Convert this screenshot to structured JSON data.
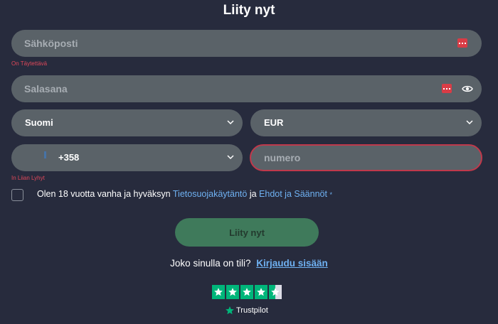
{
  "title": "Liity nyt",
  "email": {
    "placeholder": "Sähköposti",
    "error": "On Täytettävä"
  },
  "password": {
    "placeholder": "Salasana"
  },
  "country": {
    "selected": "Suomi"
  },
  "currency": {
    "selected": "EUR"
  },
  "phone": {
    "code": "+358",
    "number_placeholder": "numero",
    "error": "In Liian Lyhyt"
  },
  "consent": {
    "prefix": "Olen 18 vuotta vanha ja hyväksyn",
    "privacy_link": "Tietosuojakäytäntö",
    "middle": "ja",
    "terms_link": "Ehdot ja Säännöt",
    "required_mark": "*"
  },
  "submit_label": "Liity nyt",
  "login": {
    "question": "Joko sinulla on tili?",
    "link": "Kirjaudu sisään"
  },
  "trustpilot": {
    "label": "Trustpilot",
    "rating_stars": 4.5,
    "star_color": "#00b67a"
  },
  "colors": {
    "background": "#272b3d",
    "field": "#5a6268",
    "error": "#e0485a",
    "link": "#6fb1f2",
    "button": "#3f7a5b"
  }
}
